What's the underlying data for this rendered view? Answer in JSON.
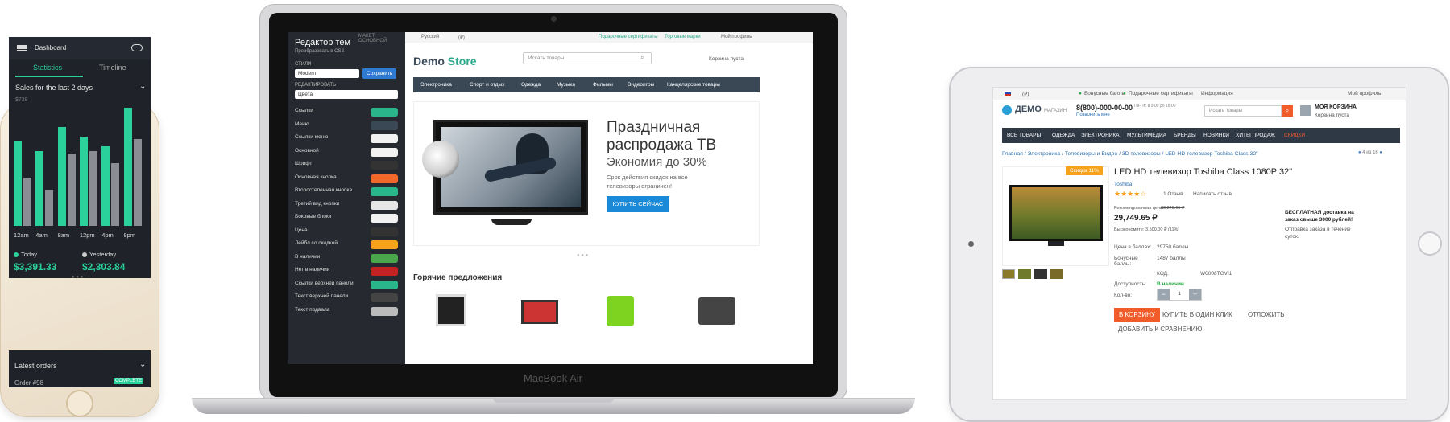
{
  "phone": {
    "header_title": "Dashboard",
    "tabs": [
      "Statistics",
      "Timeline"
    ],
    "subtitle": "Sales for the last 2 days",
    "ymax_label": "$739",
    "xlabels": [
      "12am",
      "4am",
      "8am",
      "12pm",
      "4pm",
      "8pm"
    ],
    "today_label": "Today",
    "today_value": "$3,391.33",
    "yesterday_label": "Yesterday",
    "yesterday_value": "$2,303.84",
    "latest_orders": "Latest orders",
    "order_label": "Order #98",
    "complete_badge": "COMPLETE",
    "colors": {
      "accent": "#2bd19b",
      "bars_secondary": "#8a8d93"
    },
    "bar_pairs": [
      [
        0.7,
        0.4
      ],
      [
        0.62,
        0.3
      ],
      [
        0.82,
        0.6
      ],
      [
        0.74,
        0.62
      ],
      [
        0.66,
        0.52
      ],
      [
        0.98,
        0.72
      ]
    ]
  },
  "macbook": {
    "label": "MacBook Air",
    "editor": {
      "title": "Редактор тем",
      "convert_link": "Преобразовать в CSS",
      "layout_note": "МАКЕТ: ОСНОВНОЙ",
      "styles_label": "СТИЛИ",
      "style_value": "Modern",
      "save_button": "Сохранить",
      "edit_label": "РЕДАКТИРОВАТЬ",
      "edit_value": "Цвета",
      "rows": [
        {
          "label": "Ссылки",
          "color": "#2bb58a"
        },
        {
          "label": "Меню",
          "color": "#3a4856"
        },
        {
          "label": "Ссылки меню",
          "color": "#f2f2f2"
        },
        {
          "label": "Основной",
          "color": "#f2f2f2"
        },
        {
          "label": "Шрифт",
          "color": "#333333"
        },
        {
          "label": "Основная кнопка",
          "color": "#f2682a"
        },
        {
          "label": "Второстепенная кнопка",
          "color": "#2bb58a"
        },
        {
          "label": "Третий вид кнопки",
          "color": "#e6e6e6"
        },
        {
          "label": "Боковые блоки",
          "color": "#f2f2f2"
        },
        {
          "label": "Цена",
          "color": "#333333"
        },
        {
          "label": "Лейбл со скидкой",
          "color": "#f7a21b"
        },
        {
          "label": "В наличии",
          "color": "#4aa64a"
        },
        {
          "label": "Нет в наличии",
          "color": "#c42222"
        },
        {
          "label": "Ссылки верхней панели",
          "color": "#2bb58a"
        },
        {
          "label": "Текст верхней панели",
          "color": "#444444"
        },
        {
          "label": "Текст подвала",
          "color": "#bbbbbb"
        }
      ]
    },
    "store": {
      "top_lang": "Русский",
      "top_currency": "(₽)",
      "top_gift": "Подарочные сертификаты",
      "top_brands": "Торговые марки",
      "top_profile": "Мой профиль",
      "logo_a": "Demo",
      "logo_b": "Store",
      "search_placeholder": "Искать товары",
      "cart": "Корзина пуста",
      "nav": [
        "Электроника",
        "Спорт и отдых",
        "Одежда",
        "Музыка",
        "Фильмы",
        "Видеоигры",
        "Канцелярские товары"
      ],
      "banner_h1a": "Праздничная",
      "banner_h1b": "распродажа ТВ",
      "banner_h2": "Экономия до 30%",
      "banner_p": "Срок действия скидок на все телевизоры ограничен!",
      "banner_btn": "КУПИТЬ СЕЙЧАС",
      "hot_title": "Горячие предложения"
    }
  },
  "ipad": {
    "top_bonus": "Бонусные баллы",
    "top_gift": "Подарочные сертификаты",
    "top_info": "Информация",
    "top_profile": "Мой профиль",
    "top_currency": "(₽)",
    "logo": "ДЕМО",
    "logo_sub": "МАГАЗИН",
    "phone": "8(800)-000-00-00",
    "phone_hours": "Пн-Пт: в 9:00 до 18:00",
    "callback": "Позвонить мне",
    "search_placeholder": "Искать товары",
    "cart_title": "МОЯ КОРЗИНА",
    "cart_sub": "Корзина пуста",
    "nav": [
      "ВСЕ ТОВАРЫ",
      "ОДЕЖДА",
      "ЭЛЕКТРОНИКА",
      "МУЛЬТИМЕДИА",
      "БРЕНДЫ",
      "НОВИНКИ",
      "ХИТЫ ПРОДАЖ",
      "СКИДКИ"
    ],
    "breadcrumb": "Главная / Электроника / Телевизоры и Видео / 3D телевизоры / LED HD телевизор Toshiba Class 32\"",
    "pager": "4 из 16",
    "discount": "Скидка 11%",
    "title": "LED HD телевизор Toshiba Class 1080P 32\"",
    "brand": "Toshiba",
    "reviews": "1 Отзыв",
    "write_review": "Написать отзыв",
    "rec_price_label": "Рекомендованная цена:",
    "rec_price": "33,249.65 ₽",
    "price": "29,749.65 ₽",
    "saving": "Вы экономите: 3,500.00 ₽ (11%)",
    "free_ship": "БЕСПЛАТНАЯ доставка на заказ свыше 3000 рублей!",
    "ship_note": "Отправка заказа в течение суток.",
    "points_label": "Цена в баллах:",
    "points": "29750 баллы",
    "bonus_label": "Бонусные баллы:",
    "bonus": "1487 баллы",
    "code_label": "КОД:",
    "code": "W0008TGVI1",
    "avail_label": "Доступность:",
    "avail": "В наличии",
    "qty_label": "Кол-во:",
    "qty": "1",
    "cart_btn": "В КОРЗИНУ",
    "one_click": "КУПИТЬ В ОДИН КЛИК",
    "postpone": "ОТЛОЖИТЬ",
    "compare": "ДОБАВИТЬ К СРАВНЕНИЮ",
    "rating": 4
  }
}
